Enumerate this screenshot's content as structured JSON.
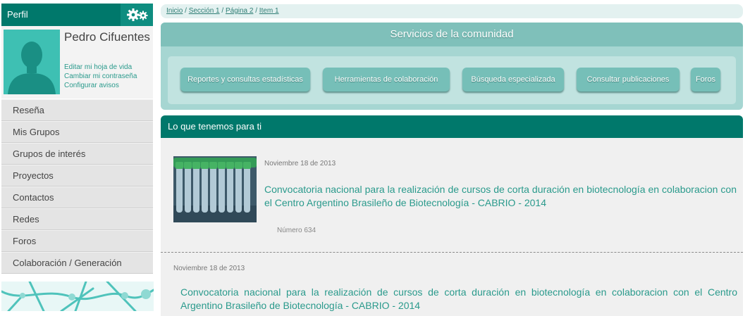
{
  "profile": {
    "header_label": "Perfil",
    "name": "Pedro Cifuentes",
    "links": {
      "cv": "Editar mi hoja de vida",
      "password": "Cambiar mi contraseña",
      "alerts": "Configurar avisos"
    }
  },
  "sidebar": {
    "menu": [
      {
        "label": "Reseña"
      },
      {
        "label": "Mis Grupos"
      },
      {
        "label": "Grupos de interés"
      },
      {
        "label": "Proyectos"
      },
      {
        "label": "Contactos"
      },
      {
        "label": "Redes"
      },
      {
        "label": "Foros"
      },
      {
        "label": "Colaboración / Generación"
      }
    ]
  },
  "breadcrumb": [
    "Inicio",
    "Sección 1",
    "Página 2",
    "Item 1"
  ],
  "services": {
    "title": "Servicios de la comunidad",
    "buttons": [
      {
        "label": "Reportes y consultas estadísticas"
      },
      {
        "label": "Herramientas de colaboración"
      },
      {
        "label": "Búsqueda especializada"
      },
      {
        "label": "Consultar publicaciones"
      },
      {
        "label": "Foros"
      }
    ]
  },
  "offers": {
    "header": "Lo que tenemos para ti",
    "items": [
      {
        "date": "Noviembre 18 de 2013",
        "title": "Convocatoria nacional para la realización de cursos de corta duración en biotecnología en colaboracion con el Centro Argentino Brasileño de Biotecnología - CABRIO - 2014",
        "number": "Número 634"
      },
      {
        "date": "Noviembre 18 de 2013",
        "title": "Convocatoria nacional para la realización de cursos de corta duración en biotecnología en colaboracion con el Centro Argentino Brasileño de Biotecnología - CABRIO - 2014"
      }
    ]
  },
  "colors": {
    "primary": "#00786b",
    "accent": "#2a9a8c",
    "services_panel": "#a6d6d2",
    "button": "#76bfb8"
  },
  "icons": {
    "settings": "gear-icon",
    "avatar": "user-silhouette-icon"
  }
}
